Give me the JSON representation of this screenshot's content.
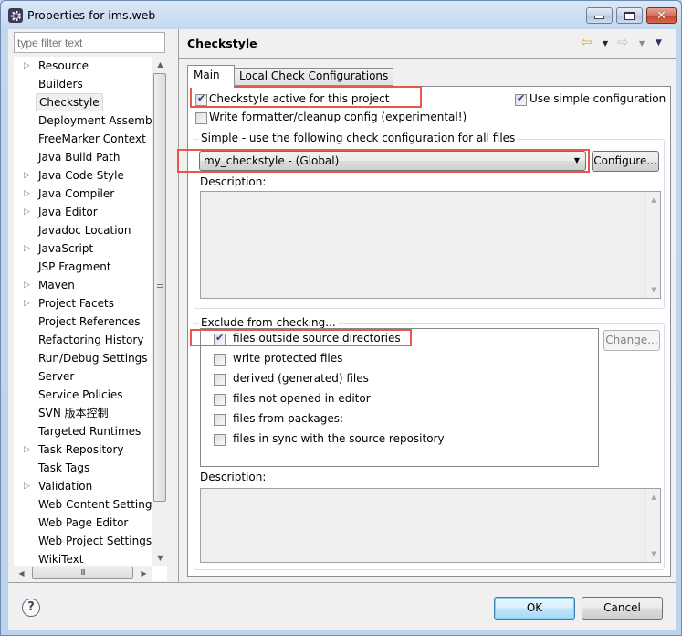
{
  "window": {
    "title": "Properties for ims.web",
    "controls": {
      "minimize": "minimize",
      "maximize": "maximize",
      "close": "✕"
    }
  },
  "sidebar": {
    "filter_placeholder": "type filter text",
    "items": [
      {
        "label": "Resource",
        "expandable": true
      },
      {
        "label": "Builders",
        "expandable": false
      },
      {
        "label": "Checkstyle",
        "expandable": false,
        "selected": true
      },
      {
        "label": "Deployment Assembly",
        "expandable": false
      },
      {
        "label": "FreeMarker Context",
        "expandable": false
      },
      {
        "label": "Java Build Path",
        "expandable": false
      },
      {
        "label": "Java Code Style",
        "expandable": true
      },
      {
        "label": "Java Compiler",
        "expandable": true
      },
      {
        "label": "Java Editor",
        "expandable": true
      },
      {
        "label": "Javadoc Location",
        "expandable": false
      },
      {
        "label": "JavaScript",
        "expandable": true
      },
      {
        "label": "JSP Fragment",
        "expandable": false
      },
      {
        "label": "Maven",
        "expandable": true
      },
      {
        "label": "Project Facets",
        "expandable": true
      },
      {
        "label": "Project References",
        "expandable": false
      },
      {
        "label": "Refactoring History",
        "expandable": false
      },
      {
        "label": "Run/Debug Settings",
        "expandable": false
      },
      {
        "label": "Server",
        "expandable": false
      },
      {
        "label": "Service Policies",
        "expandable": false
      },
      {
        "label": "SVN 版本控制",
        "expandable": false
      },
      {
        "label": "Targeted Runtimes",
        "expandable": false
      },
      {
        "label": "Task Repository",
        "expandable": true
      },
      {
        "label": "Task Tags",
        "expandable": false
      },
      {
        "label": "Validation",
        "expandable": true
      },
      {
        "label": "Web Content Settings",
        "expandable": false
      },
      {
        "label": "Web Page Editor",
        "expandable": false
      },
      {
        "label": "Web Project Settings",
        "expandable": false
      },
      {
        "label": "WikiText",
        "expandable": false
      }
    ],
    "scroll_glyphs": {
      "up": "▲",
      "down": "▼",
      "left": "◀",
      "right": "▶",
      "grip": "III"
    }
  },
  "page": {
    "title": "Checkstyle",
    "nav": {
      "back": "⇦",
      "forward": "⇨",
      "dropdown": "▼",
      "menu": "▼"
    },
    "tabs": [
      {
        "label": "Main",
        "active": true
      },
      {
        "label": "Local Check Configurations",
        "active": false
      }
    ],
    "main": {
      "checkstyle_active": {
        "label": "Checkstyle active for this project",
        "checked": true
      },
      "use_simple_config": {
        "label": "Use simple configuration",
        "checked": true
      },
      "write_formatter": {
        "label": "Write formatter/cleanup config (experimental!)",
        "checked": false
      },
      "simple_group_title": "Simple - use the following check configuration for all files",
      "config_combo_value": "my_checkstyle  - (Global)",
      "configure_button": "Configure...",
      "description_label": "Description:",
      "exclude_group_title": "Exclude from checking...",
      "exclude_filters": [
        {
          "label": "files outside source directories",
          "checked": true
        },
        {
          "label": "write protected files",
          "checked": false
        },
        {
          "label": "derived (generated) files",
          "checked": false
        },
        {
          "label": "files not opened in editor",
          "checked": false
        },
        {
          "label": "files from packages:",
          "checked": false
        },
        {
          "label": "files in sync with the source repository",
          "checked": false
        }
      ],
      "change_button": "Change...",
      "exclude_description_label": "Description:"
    }
  },
  "footer": {
    "help": "?",
    "ok": "OK",
    "cancel": "Cancel"
  },
  "highlight_color": "#e8574a"
}
